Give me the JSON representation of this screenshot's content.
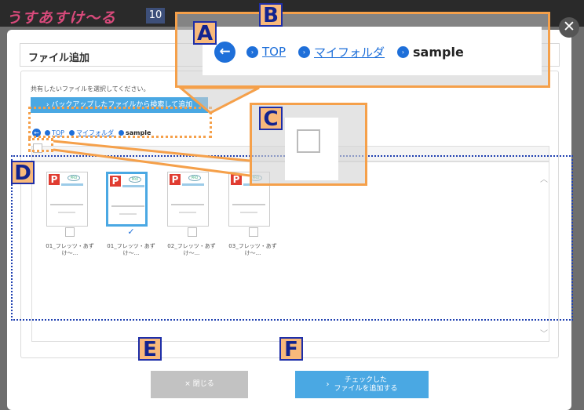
{
  "background": {
    "logo_text": "うすあすけ〜る",
    "badge_number": "10"
  },
  "modal": {
    "title": "ファイル追加",
    "close_glyph": "✕",
    "instruction": "共有したいファイルを選択してください。",
    "search_button_label": "バックアップしたファイルから検索して追加",
    "breadcrumb": {
      "back_glyph": "←",
      "links": [
        "TOP",
        "マイフォルダ"
      ],
      "current": "sample"
    },
    "files": [
      {
        "name": "01_フレッツ・あずけ〜...",
        "checked": false
      },
      {
        "name": "01_フレッツ・あずけ〜...",
        "checked": true
      },
      {
        "name": "02_フレッツ・あずけ〜...",
        "checked": false
      },
      {
        "name": "03_フレッツ・あずけ〜...",
        "checked": false
      }
    ],
    "thumb_logo": "P",
    "thumb_pro": "PRO",
    "check_glyph": "✓",
    "close_button_label": "× 閉じる",
    "add_button_line1": "チェックした",
    "add_button_line2": "ファイルを追加する",
    "chevron": "›"
  },
  "annotations": {
    "labels": [
      "A",
      "B",
      "C",
      "D",
      "E",
      "F"
    ]
  },
  "colors": {
    "accent_blue": "#4aa8e3",
    "link_blue": "#1e6fd9",
    "annotation_orange": "#f5a04a",
    "annotation_blue": "#1e3fb0",
    "disabled_gray": "#c2c2c2"
  }
}
